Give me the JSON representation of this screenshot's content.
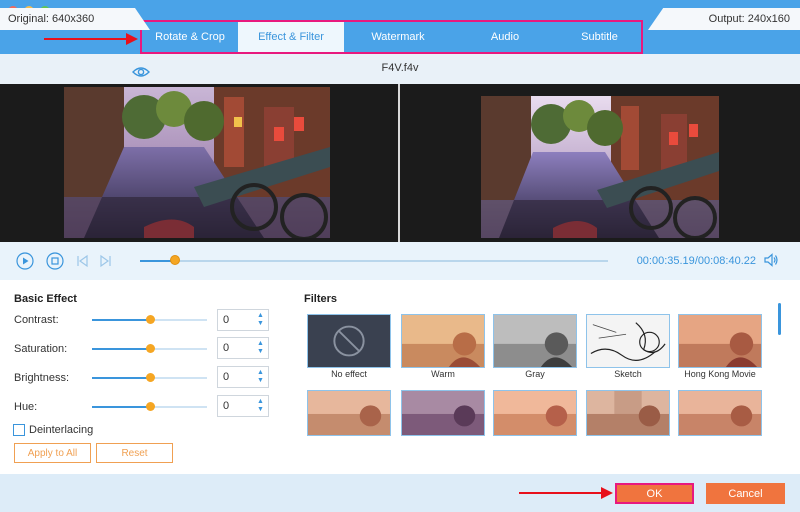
{
  "window": {
    "controls": [
      "close",
      "minimize",
      "zoom"
    ]
  },
  "tabs": [
    {
      "label": "Rotate & Crop",
      "active": false
    },
    {
      "label": "Effect & Filter",
      "active": true
    },
    {
      "label": "Watermark",
      "active": false
    },
    {
      "label": "Audio",
      "active": false
    },
    {
      "label": "Subtitle",
      "active": false
    }
  ],
  "info": {
    "original": "Original: 640x360",
    "filename": "F4V.f4v",
    "output": "Output: 240x160"
  },
  "playback": {
    "current_time": "00:00:35.19",
    "separator": "/",
    "total_time": "00:08:40.22",
    "progress": 0.075
  },
  "basic_effect": {
    "title": "Basic Effect",
    "rows": [
      {
        "label": "Contrast:",
        "value": "0",
        "level": 0.5
      },
      {
        "label": "Saturation:",
        "value": "0",
        "level": 0.5
      },
      {
        "label": "Brightness:",
        "value": "0",
        "level": 0.5
      },
      {
        "label": "Hue:",
        "value": "0",
        "level": 0.5
      }
    ],
    "deinterlacing_label": "Deinterlacing",
    "deinterlacing_checked": false,
    "apply_all_label": "Apply to All",
    "reset_label": "Reset"
  },
  "filters": {
    "title": "Filters",
    "items": [
      {
        "label": "No effect",
        "style": "none"
      },
      {
        "label": "Warm",
        "style": "warm"
      },
      {
        "label": "Gray",
        "style": "gray"
      },
      {
        "label": "Sketch",
        "style": "sketch"
      },
      {
        "label": "Hong Kong Movie",
        "style": "hk"
      },
      {
        "label": "",
        "style": "row2-a"
      },
      {
        "label": "",
        "style": "row2-b"
      },
      {
        "label": "",
        "style": "row2-c"
      },
      {
        "label": "",
        "style": "row2-d"
      },
      {
        "label": "",
        "style": "row2-e"
      }
    ]
  },
  "footer": {
    "ok_label": "OK",
    "cancel_label": "Cancel"
  },
  "colors": {
    "accent": "#3a95dc",
    "titlebar": "#4aa3e8",
    "highlight_border": "#e8197e",
    "arrow": "#e8101b",
    "primary_button": "#f0743e",
    "slider_thumb": "#f5a623"
  }
}
